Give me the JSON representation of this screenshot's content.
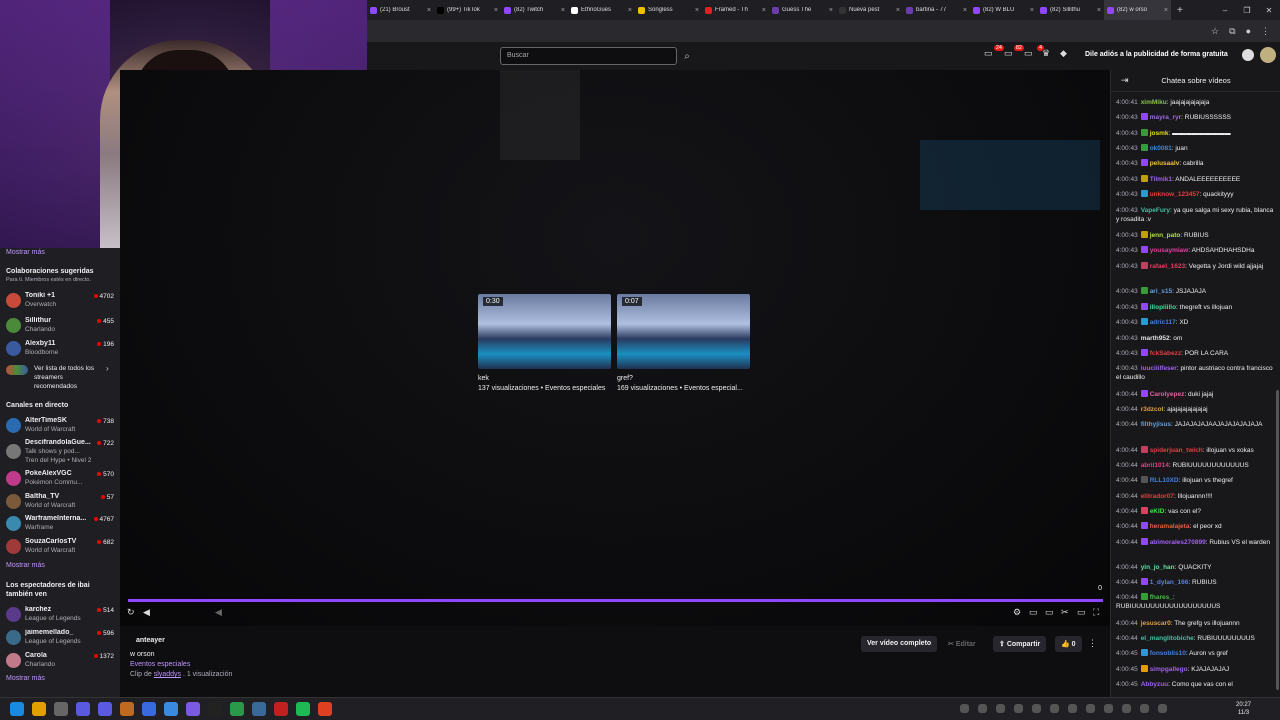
{
  "browser": {
    "tabs": [
      {
        "label": "(21) Broust",
        "color": "#9147ff"
      },
      {
        "label": "(99+) TikTok",
        "color": "#000000"
      },
      {
        "label": "(82) Twitch",
        "color": "#9147ff"
      },
      {
        "label": "EthnoGues",
        "color": "#ffffff"
      },
      {
        "label": "Songless",
        "color": "#f0c000"
      },
      {
        "label": "Framed - Th",
        "color": "#e02020"
      },
      {
        "label": "Guess The",
        "color": "#6a3cb0"
      },
      {
        "label": "Nueva pest",
        "color": "#333333"
      },
      {
        "label": "bartina - 77",
        "color": "#6a3cb0"
      },
      {
        "label": "(82) W BLU",
        "color": "#9147ff"
      },
      {
        "label": "(82) Sillithu",
        "color": "#9147ff"
      },
      {
        "label": "(82) w orso",
        "color": "#9147ff",
        "active": true
      }
    ],
    "new_tab": "+",
    "window_controls": [
      "–",
      "❐",
      "✕"
    ]
  },
  "header": {
    "search_placeholder": "Buscar",
    "notif_counts": [
      "24",
      "82",
      "4"
    ],
    "ads_label": "Dile adiós a la publicidad de forma gratuita",
    "avatar_badge": "16"
  },
  "sidebar": {
    "more_top": "Mostrar más",
    "suggested_title": "Colaboraciones sugeridas",
    "suggested_sub": "Para ti. Miembros estés en directo.",
    "suggested": [
      {
        "name": "Toniki +1",
        "game": "Overwatch",
        "viewers": "4702",
        "color": "#c84a3a"
      },
      {
        "name": "Sillithur",
        "game": "Charlando",
        "viewers": "455",
        "color": "#4a8a3a"
      },
      {
        "name": "Alexby11",
        "game": "Bloodborne",
        "viewers": "196",
        "color": "#3a5aa0"
      }
    ],
    "see_all": "Ver lista de todos los streamers recomendados",
    "live_title": "Canales en directo",
    "live": [
      {
        "name": "AlterTimeSK",
        "game": "World of Warcraft",
        "viewers": "738",
        "color": "#2a6ab0"
      },
      {
        "name": "DescifrandolaGue...",
        "game": "Talk shows y pod...",
        "viewers": "722",
        "color": "#777777"
      },
      {
        "name": "",
        "game": "Tren del Hype • Nivel 2",
        "viewers": "",
        "color": ""
      },
      {
        "name": "PokeAlexVGC",
        "game": "Pokémon Commu...",
        "viewers": "570",
        "color": "#c03a8a"
      },
      {
        "name": "Baltha_TV",
        "game": "World of Warcraft",
        "viewers": "57",
        "color": "#7a5a3a"
      },
      {
        "name": "WarframeInterna...",
        "game": "Warframe",
        "viewers": "4767",
        "color": "#3a8ab0"
      },
      {
        "name": "SouzaCarlosTV",
        "game": "World of Warcraft",
        "viewers": "682",
        "color": "#a03a3a"
      }
    ],
    "more_mid": "Mostrar más",
    "also_title": "Los espectadores de ibai también ven",
    "also": [
      {
        "name": "karchez",
        "game": "League of Legends",
        "viewers": "514",
        "color": "#5a3a8a"
      },
      {
        "name": "jaimemellado_",
        "game": "League of Legends",
        "viewers": "596",
        "color": "#3a6a8a"
      },
      {
        "name": "Carola",
        "game": "Charlando",
        "viewers": "1372",
        "color": "#c07a8a"
      }
    ],
    "more_bottom": "Mostrar más"
  },
  "player": {
    "clips": [
      {
        "duration": "0:30",
        "title": "kek",
        "meta": "137 visualizaciones • Eventos especiales"
      },
      {
        "duration": "0:07",
        "title": "gref?",
        "meta": "169 visualizaciones • Eventos especial..."
      }
    ],
    "progress": 1.0,
    "counter": "0"
  },
  "below": {
    "author": "anteayer",
    "title": "w orson",
    "category": "Eventos especiales",
    "clip_prefix": "Clip de",
    "clip_user": "slyaddys",
    "clip_suffix": ". 1 visualización",
    "full_video": "Ver vídeo completo",
    "edit": "Editar",
    "share": "Compartir",
    "likes": "0"
  },
  "chat": {
    "header": "Chatea sobre vídeos",
    "messages": [
      {
        "time": "4:00:41",
        "user": "ximMiku",
        "color": "#8bc34a",
        "badge": "",
        "text": "jaajajajajajaja"
      },
      {
        "time": "4:00:43",
        "user": "mayra_ryr",
        "color": "#9c6ade",
        "badge": "#9147ff",
        "text": "RUBIUSSSSSS"
      },
      {
        "time": "4:00:43",
        "user": "josmk",
        "color": "#e0e000",
        "badge": "#3a9a3a",
        "text": "▬▬▬▬▬▬▬▬▬"
      },
      {
        "time": "4:00:43",
        "user": "ok0081",
        "color": "#3a8ae0",
        "badge": "#3a9a3a",
        "text": "juan"
      },
      {
        "time": "4:00:43",
        "user": "pelusaalv",
        "color": "#f0c040",
        "badge": "#9147ff",
        "text": "cabrilla"
      },
      {
        "time": "4:00:43",
        "user": "Tilmik1",
        "color": "#a060f0",
        "badge": "#c0a000",
        "text": "ANDALEEEEEEEEEE"
      },
      {
        "time": "4:00:43",
        "user": "unknow_123457",
        "color": "#e04040",
        "badge": "#2a9ad0",
        "text": "quackityyy"
      },
      {
        "time": "4:00:43",
        "user": "VapeFury",
        "color": "#40c0a0",
        "badge": "",
        "text": "ya que salga mi sexy rubia, blanca y rosadita :v"
      },
      {
        "time": "4:00:43",
        "user": "jenn_pato",
        "color": "#b0e040",
        "badge": "#c0a000",
        "text": "RUBIUS"
      },
      {
        "time": "4:00:43",
        "user": "yousaymiaw",
        "color": "#e040a0",
        "badge": "#9147ff",
        "text": "AHDSAHDHAHSDHa"
      },
      {
        "time": "4:00:43",
        "user": "rafael_1623",
        "color": "#e04060",
        "badge": "#c04060",
        "text": "Vegetta y Jordi wild ajjajaj"
      },
      {
        "time": "4:00:43",
        "user": "ari_s15",
        "color": "#60a0e0",
        "badge": "#3a9a3a",
        "text": "JSJAJAJA"
      },
      {
        "time": "4:00:43",
        "user": "illopiiillo",
        "color": "#40e0a0",
        "badge": "#9147ff",
        "text": "thegreft vs illojuan"
      },
      {
        "time": "4:00:43",
        "user": "adric117",
        "color": "#4080e0",
        "badge": "#2a9ad0",
        "text": "XD"
      },
      {
        "time": "4:00:43",
        "user": "marth952",
        "color": "#e0e0e0",
        "badge": "",
        "text": "om"
      },
      {
        "time": "4:00:43",
        "user": "fckSabezz",
        "color": "#e04040",
        "badge": "#9147ff",
        "text": "POR LA CARA"
      },
      {
        "time": "4:00:43",
        "user": "iuuciiilfeser",
        "color": "#a060f0",
        "badge": "",
        "text": "pintor austriaco contra francisco el caudillo"
      },
      {
        "time": "4:00:44",
        "user": "Carolyepez",
        "color": "#e060a0",
        "badge": "#9147ff",
        "text": "duki jajaj"
      },
      {
        "time": "4:00:44",
        "user": "r3dzcol",
        "color": "#e0a040",
        "badge": "",
        "text": "ajajajajajajajaj"
      },
      {
        "time": "4:00:44",
        "user": "filthyjisus",
        "color": "#60a0e0",
        "badge": "",
        "text": "JAJAJAJAJAAJAJAJAJAJAJA"
      },
      {
        "time": "4:00:44",
        "user": "spiderjuan_twich",
        "color": "#e04040",
        "badge": "#c04060",
        "text": "illojuan vs xokas"
      },
      {
        "time": "4:00:44",
        "user": "abril1014",
        "color": "#e04080",
        "badge": "",
        "text": "RUBIUUUUUUUUUUUUS"
      },
      {
        "time": "4:00:44",
        "user": "RLL10XD",
        "color": "#4080e0",
        "badge": "#555555",
        "text": "illojuan vs thegref"
      },
      {
        "time": "4:00:44",
        "user": "elitrador07",
        "color": "#e04040",
        "badge": "",
        "text": "Illojuannn!!!!"
      },
      {
        "time": "4:00:44",
        "user": "eKID",
        "color": "#40e040",
        "badge": "#e04060",
        "text": "vas con el?"
      },
      {
        "time": "4:00:44",
        "user": "heramalajeta",
        "color": "#e06040",
        "badge": "#9147ff",
        "text": "el peor xd"
      },
      {
        "time": "4:00:44",
        "user": "abimorales270899",
        "color": "#a060f0",
        "badge": "#9147ff",
        "text": "Rubius VS el warden"
      },
      {
        "time": "4:00:44",
        "user": "yin_jo_han",
        "color": "#60e0a0",
        "badge": "",
        "text": "QUACKITY"
      },
      {
        "time": "4:00:44",
        "user": "1_dylan_166",
        "color": "#6080e0",
        "badge": "#9147ff",
        "text": "RUBIUS"
      },
      {
        "time": "4:00:44",
        "user": "fhares_",
        "color": "#40c040",
        "badge": "#3a9a3a",
        "text": "RUBIUUUUUUUUUUUUUUUUUUS"
      },
      {
        "time": "4:00:44",
        "user": "jesuscar0",
        "color": "#e0a040",
        "badge": "",
        "text": "The grefg vs illojuannn"
      },
      {
        "time": "4:00:44",
        "user": "el_manglitobiche",
        "color": "#40c0a0",
        "badge": "",
        "text": "RUBIUUUUUUUUS"
      },
      {
        "time": "4:00:45",
        "user": "fonsoblis10",
        "color": "#4080e0",
        "badge": "#2a9ad0",
        "text": "Auron vs gref"
      },
      {
        "time": "4:00:45",
        "user": "simpgallego",
        "color": "#a060f0",
        "badge": "#e0a000",
        "text": "KJAJAJAJAJ"
      },
      {
        "time": "4:00:45",
        "user": "Abbyzuu",
        "color": "#a060f0",
        "badge": "",
        "text": "Como que vas con el"
      }
    ]
  },
  "taskbar": {
    "time": "20:27",
    "date": "11/3"
  }
}
